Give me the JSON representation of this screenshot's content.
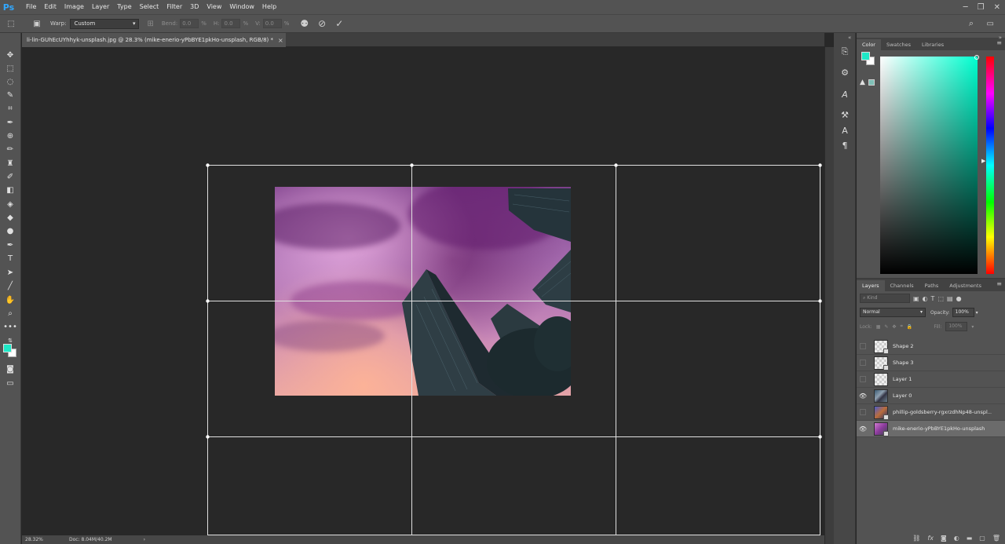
{
  "menubar": {
    "logo": "Ps",
    "items": [
      "File",
      "Edit",
      "Image",
      "Layer",
      "Type",
      "Select",
      "Filter",
      "3D",
      "View",
      "Window",
      "Help"
    ]
  },
  "options_bar": {
    "warp_label": "Warp:",
    "warp_value": "Custom",
    "bend_label": "Bend:",
    "bend_value": "0.0",
    "h_label": "H:",
    "h_value": "0.0",
    "v_label": "V:",
    "v_value": "0.0",
    "percent": "%"
  },
  "document": {
    "tab_title": "li-lin-GUhEcUYhhyk-unsplash.jpg @ 28.3% (mike-enerio-yPbBYE1pkHo-unsplash, RGB/8) *",
    "close": "×"
  },
  "status": {
    "zoom": "28.32%",
    "doc": "Doc: 8.04M/40.2M",
    "arrow": "›"
  },
  "color_panel": {
    "tabs": [
      "Color",
      "Swatches",
      "Libraries"
    ],
    "foreground_color": "#1ee8c7",
    "background_color": "#ffffff"
  },
  "layers_panel": {
    "tabs": [
      "Layers",
      "Channels",
      "Paths",
      "Adjustments"
    ],
    "kind_label": "Kind",
    "blend_mode": "Normal",
    "opacity_label": "Opacity:",
    "opacity_value": "100%",
    "lock_label": "Lock:",
    "fill_label": "Fill:",
    "fill_value": "100%",
    "layers": [
      {
        "name": "Shape 2",
        "visible": false,
        "selected": false
      },
      {
        "name": "Shape 3",
        "visible": false,
        "selected": false
      },
      {
        "name": "Layer 1",
        "visible": false,
        "selected": false
      },
      {
        "name": "Layer 0",
        "visible": true,
        "selected": false
      },
      {
        "name": "phillip-goldsberry-rgxrzdhNp48-unspl...",
        "visible": false,
        "selected": false
      },
      {
        "name": "mike-enerio-yPbBYE1pkHo-unsplash",
        "visible": true,
        "selected": true
      }
    ]
  }
}
